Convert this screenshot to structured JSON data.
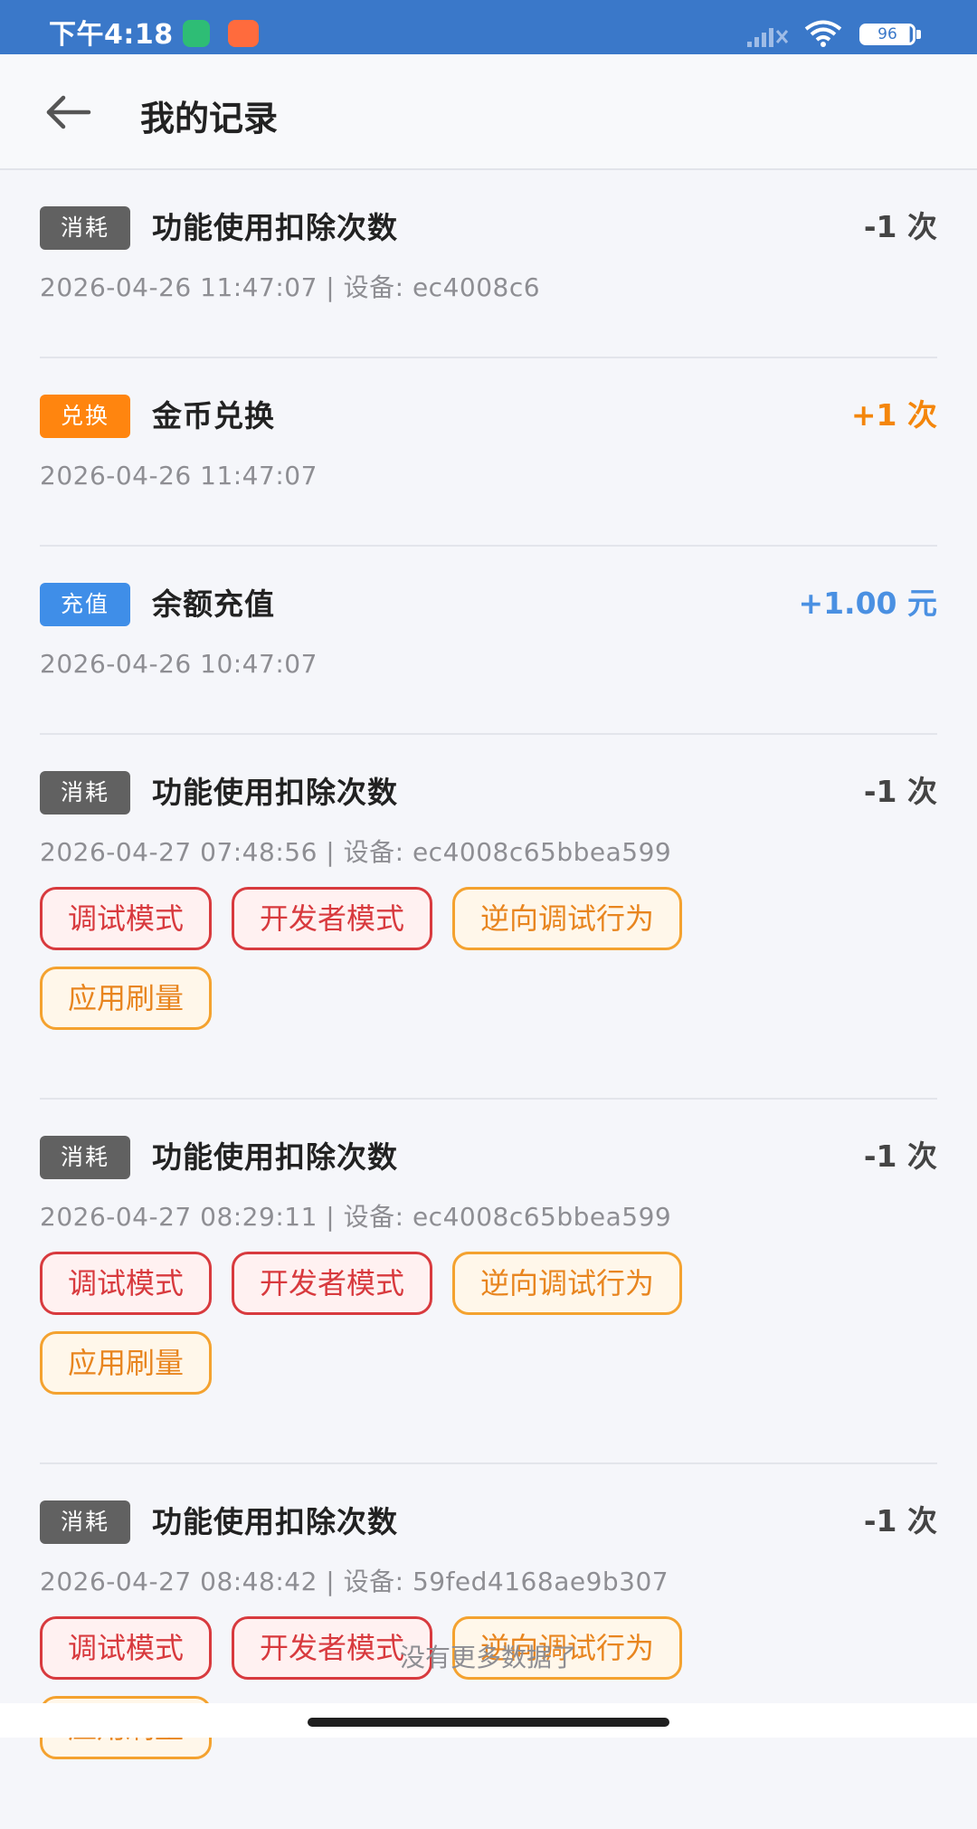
{
  "status_bar": {
    "time": "下午4:18",
    "battery": "96"
  },
  "header": {
    "title": "我的记录"
  },
  "records": [
    {
      "badge": "消耗",
      "title": "功能使用扣除次数",
      "amount": "-1 次",
      "meta": "2026-04-26 11:47:07 | 设备: ec4008c6",
      "tags": []
    },
    {
      "badge": "兑换",
      "title": "金币兑换",
      "amount": "+1 次",
      "meta": "2026-04-26 11:47:07",
      "tags": []
    },
    {
      "badge": "充值",
      "title": "余额充值",
      "amount": "+1.00 元",
      "meta": "2026-04-26 10:47:07",
      "tags": []
    },
    {
      "badge": "消耗",
      "title": "功能使用扣除次数",
      "amount": "-1 次",
      "meta": "2026-04-27 07:48:56 | 设备: ec4008c65bbea599",
      "tags": [
        "调试模式",
        "开发者模式",
        "逆向调试行为",
        "应用刷量"
      ]
    },
    {
      "badge": "消耗",
      "title": "功能使用扣除次数",
      "amount": "-1 次",
      "meta": "2026-04-27 08:29:11 | 设备: ec4008c65bbea599",
      "tags": [
        "调试模式",
        "开发者模式",
        "逆向调试行为",
        "应用刷量"
      ]
    },
    {
      "badge": "消耗",
      "title": "功能使用扣除次数",
      "amount": "-1 次",
      "meta": "2026-04-27 08:48:42 | 设备: 59fed4168ae9b307",
      "tags": [
        "调试模式",
        "开发者模式",
        "逆向调试行为",
        "应用刷量"
      ]
    }
  ],
  "footer": {
    "message": "没有更多数据了"
  },
  "colors": {
    "status_bar": "#3a78c9",
    "consume_badge": "#616161",
    "exchange_badge": "#ff850f",
    "recharge_badge": "#3f8ee8",
    "tag_red": "#d83a3e",
    "tag_orange": "#f4a22f"
  },
  "icons": {
    "back": "left-arrow-icon",
    "shield": "shield-status-icon",
    "bag": "shopping-bag-status-icon",
    "signal": "signal-icon",
    "wifi": "wifi-icon",
    "battery": "battery-icon"
  }
}
